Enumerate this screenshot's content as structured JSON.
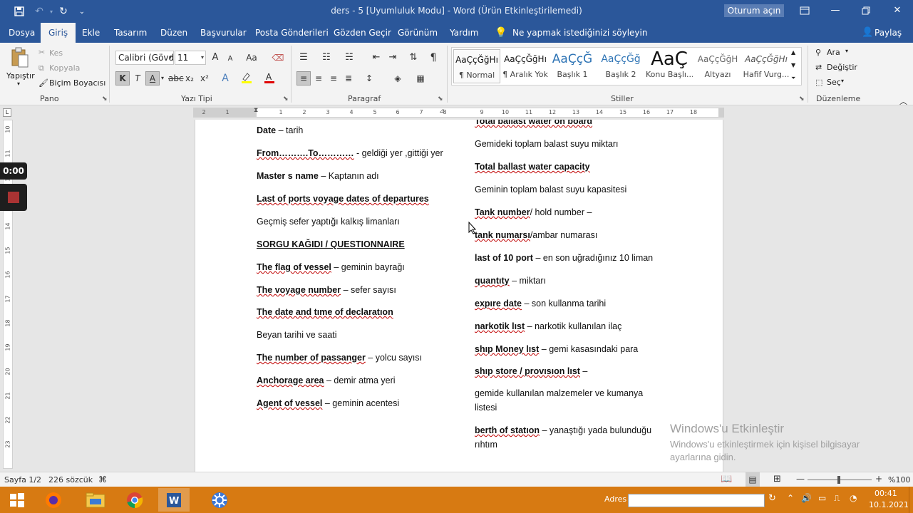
{
  "title_bar": {
    "title": "ders - 5 [Uyumluluk Modu]  -  Word (Ürün Etkinleştirilemedi)",
    "signin": "Oturum açın",
    "qat_more": "⌄"
  },
  "menu": {
    "tabs": [
      "Dosya",
      "Giriş",
      "Ekle",
      "Tasarım",
      "Düzen",
      "Başvurular",
      "Posta Gönderileri",
      "Gözden Geçir",
      "Görünüm",
      "Yardım"
    ],
    "tell_me": "Ne yapmak istediğinizi söyleyin",
    "share": "Paylaş"
  },
  "ribbon": {
    "clipboard": {
      "paste": "Yapıştır",
      "cut": "Kes",
      "copy": "Kopyala",
      "format_painter": "Biçim Boyacısı",
      "label": "Pano"
    },
    "font": {
      "name": "Calibri (Gövd",
      "size": "11",
      "bold": "K",
      "italic": "T",
      "underline": "A",
      "subscript": "x₂",
      "superscript": "x²",
      "grow": "A",
      "shrink": "A",
      "case": "Aa",
      "label": "Yazı Tipi"
    },
    "paragraph": {
      "label": "Paragraf"
    },
    "styles": {
      "label": "Stiller",
      "items": [
        {
          "preview": "AaÇçĞğHı",
          "name": "¶ Normal"
        },
        {
          "preview": "AaÇçĞğHı",
          "name": "¶ Aralık Yok"
        },
        {
          "preview": "AaÇçĞ",
          "name": "Başlık 1"
        },
        {
          "preview": "AaÇçĞğ",
          "name": "Başlık 2"
        },
        {
          "preview": "AaÇ",
          "name": "Konu Başlı..."
        },
        {
          "preview": "AaÇçĞğH",
          "name": "Altyazı"
        },
        {
          "preview": "AaÇçĞğHı",
          "name": "Hafif Vurg..."
        }
      ]
    },
    "editing": {
      "find": "Ara",
      "replace": "Değiştir",
      "select": "Seç",
      "label": "Düzenleme"
    }
  },
  "ruler": {
    "h_ticks": [
      "2",
      "1",
      "1",
      "2",
      "3",
      "4",
      "5",
      "6",
      "7",
      "8",
      "9",
      "10",
      "11",
      "12",
      "13",
      "14",
      "15",
      "16",
      "17",
      "18"
    ],
    "v_ticks": [
      "10",
      "11",
      "12",
      "13",
      "14",
      "15",
      "16",
      "17",
      "18",
      "19",
      "20",
      "21",
      "22",
      "23"
    ]
  },
  "recorder": {
    "time": "0:00"
  },
  "document": {
    "left_column": [
      {
        "bold": "Date",
        "rest": " – tarih"
      },
      {
        "bold": "From……….To…………",
        "rest": " - geldiği yer ,gittiği yer"
      },
      {
        "bold": "Master s name",
        "rest": " – Kaptanın adı"
      },
      {
        "bold": "Last of ports voyage dates of departures",
        "rest": ""
      },
      {
        "bold": "",
        "rest": "Geçmiş sefer yaptığı kalkış limanları"
      },
      {
        "bold": "SORGU KAĞIDI / QUESTIONNAIRE",
        "rest": ""
      },
      {
        "bold": "The flag of vessel",
        "rest": " – geminin bayrağı"
      },
      {
        "bold": "The voyage number",
        "rest": " – sefer sayısı"
      },
      {
        "bold": "The date  and tıme of declaratıon",
        "rest": ""
      },
      {
        "bold": "",
        "rest": "Beyan tarihi ve saati"
      },
      {
        "bold": "The number of passanger",
        "rest": " – yolcu sayısı"
      },
      {
        "bold": "Anchorage area",
        "rest": " – demir atma yeri"
      },
      {
        "bold": "Agent of vessel",
        "rest": " – geminin acentesi"
      }
    ],
    "right_column": [
      {
        "bold": "Total ballast water on board",
        "rest": ""
      },
      {
        "bold": "",
        "rest": "Gemideki toplam balast suyu miktarı"
      },
      {
        "bold": "Total ballast  water capacity",
        "rest": ""
      },
      {
        "bold": "",
        "rest": "Geminin toplam balast suyu kapasitesi"
      },
      {
        "bold": "Tank number",
        "rest": "/ hold number –"
      },
      {
        "bold": " tank numarsı",
        "rest": "/ambar numarası"
      },
      {
        "bold": "last of 10 port",
        "rest": " – en son uğradığınız 10 liman"
      },
      {
        "bold": "quantıty",
        "rest": " – miktarı"
      },
      {
        "bold": "expıre date",
        "rest": " – son kullanma tarihi"
      },
      {
        "bold": "narkotik lıst",
        "rest": " – narkotik kullanılan ilaç"
      },
      {
        "bold": "shıp Money lıst",
        "rest": " – gemi kasasındaki para"
      },
      {
        "bold": "shıp store / provısıon lıst",
        "rest": " –"
      },
      {
        "bold": "",
        "rest": "gemide kullanılan malzemeler ve kumanya"
      },
      {
        "bold": "",
        "rest": "listesi"
      },
      {
        "bold": "berth of statıon",
        "rest": " – yanaştığı yada bulunduğu"
      },
      {
        "bold": "",
        "rest": "rıhtım"
      }
    ]
  },
  "activation": {
    "title": "Windows'u Etkinleştir",
    "line1": "Windows'u etkinleştirmek için kişisel bilgisayar",
    "line2": "ayarlarına gidin."
  },
  "status_bar": {
    "page": "Sayfa 1/2",
    "words": "226 sözcük",
    "zoom": "%100"
  },
  "taskbar": {
    "address_label": "Adres",
    "time": "00:41",
    "date": "10.1.2021",
    "apps": [
      "firefox",
      "file-explorer",
      "chrome",
      "word",
      "app"
    ],
    "colors": {
      "taskbar": "#d77a12",
      "title": "#2b579a"
    }
  }
}
